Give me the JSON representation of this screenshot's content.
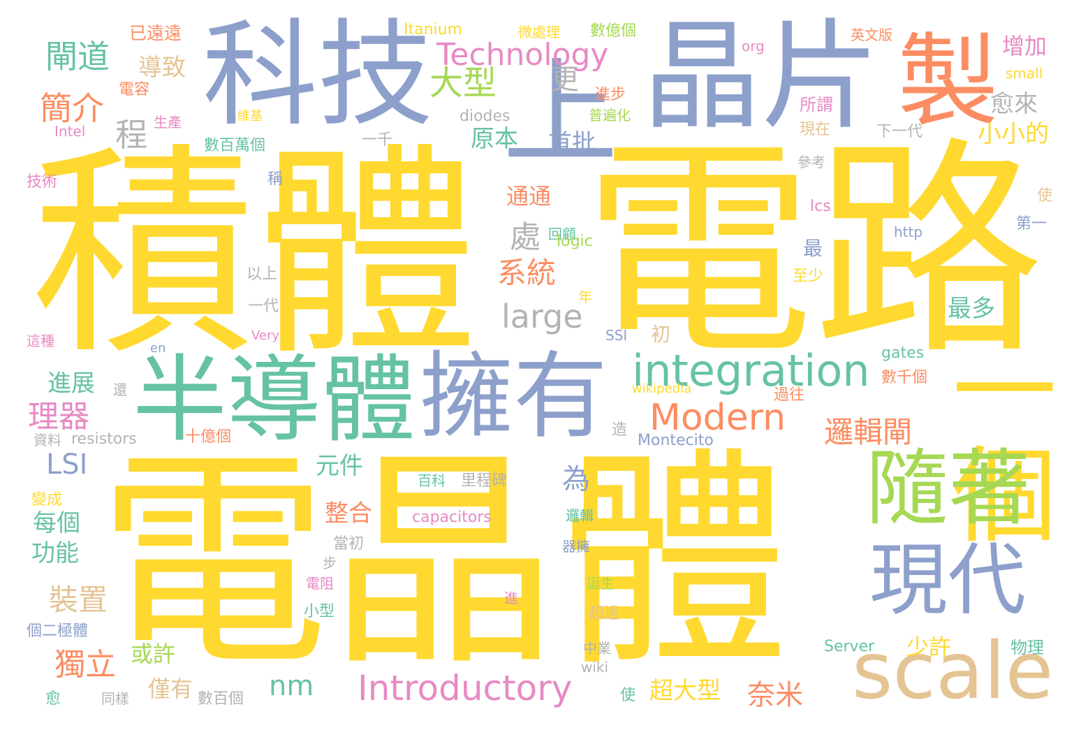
{
  "palette": {
    "yellow": "#ffd92f",
    "blue": "#8da0cb",
    "green": "#66c2a5",
    "orange": "#fc8d62",
    "pink": "#e78ac3",
    "lime": "#a6d854",
    "tan": "#e5c494",
    "gray": "#b3b3b3"
  },
  "words": [
    "電晶體",
    "電路",
    "積體",
    "科技",
    "晶片",
    "製",
    "上",
    "半導體",
    "擁有",
    "一個",
    "隨著",
    "現代",
    "scale",
    "integration",
    "Technology",
    "Modern",
    "Introductory",
    "large",
    "大型",
    "更",
    "簡介",
    "閘道",
    "導致",
    "已遠遠",
    "Itanium",
    "微處理",
    "數億個",
    "英文版",
    "org",
    "增加",
    "small",
    "愈來",
    "所謂",
    "現在",
    "下一代",
    "參考",
    "小小的",
    "首批",
    "原本",
    "程",
    "處",
    "系統",
    "通通",
    "回顧",
    "logic",
    "進步",
    "普遍化",
    "diodes",
    "一千",
    "數百萬個",
    "維基",
    "生產",
    "電容",
    "Intel",
    "技術",
    "稱",
    "lcs",
    "http",
    "使",
    "第一",
    "最",
    "至少",
    "以上",
    "一代",
    "年",
    "最多",
    "SSI",
    "初",
    "Very",
    "en",
    "這種",
    "gates",
    "wikipedia",
    "數千個",
    "過往",
    "進展",
    "理器",
    "還",
    "resistors",
    "十億個",
    "Montecito",
    "造",
    "資料",
    "LSI",
    "邏輯閘",
    "元件",
    "為",
    "百科",
    "里程碑",
    "變成",
    "每個",
    "功能",
    "整合",
    "capacitors",
    "邏輯",
    "器擁",
    "當初",
    "步",
    "裝置",
    "電阻",
    "誕生",
    "進",
    "超過",
    "小型",
    "個二極體",
    "獨立",
    "或許",
    "僅有",
    "愈",
    "同樣",
    "數百個",
    "使",
    "超大型",
    "nm",
    "中業",
    "wiki",
    "奈米",
    "少許",
    "Server",
    "物理"
  ]
}
